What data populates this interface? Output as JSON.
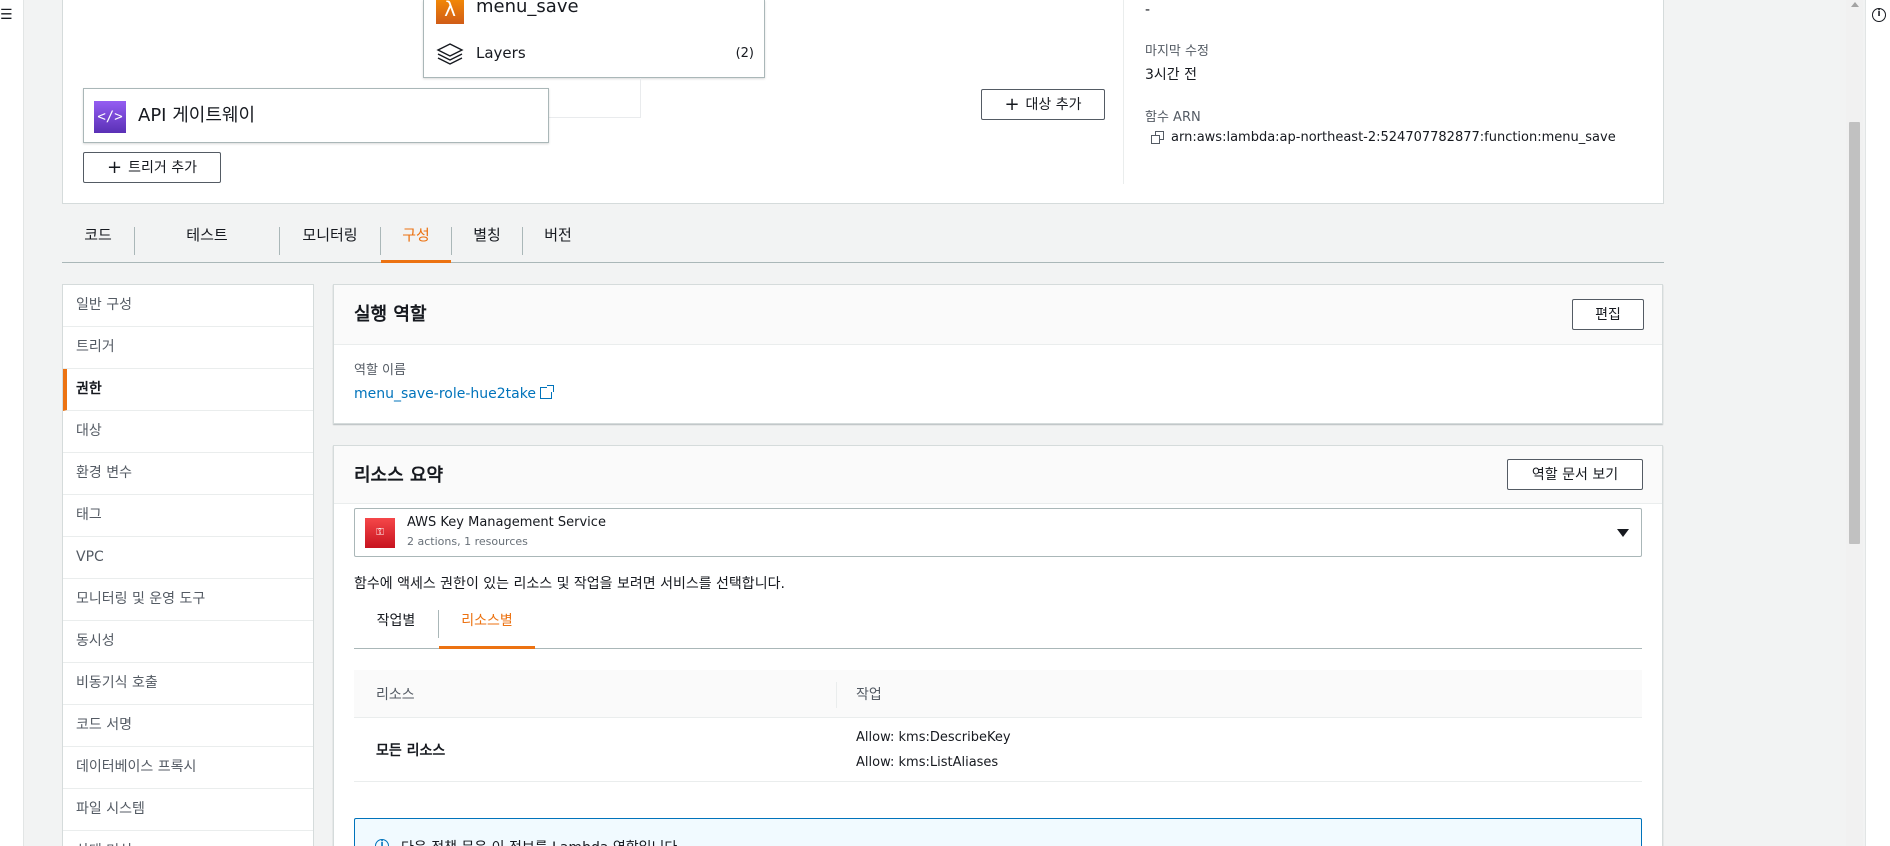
{
  "function_overview": {
    "function_name": "menu_save",
    "layers_label": "Layers",
    "layers_count": "(2)",
    "trigger_label": "API 게이트웨이",
    "add_trigger_label": "트리거 추가",
    "add_destination_label": "대상 추가",
    "description_value": "-",
    "last_modified_label": "마지막 수정",
    "last_modified_value": "3시간 전",
    "arn_label": "함수 ARN",
    "arn_value": "arn:aws:lambda:ap-northeast-2:524707782877:function:menu_save"
  },
  "tabs": [
    {
      "label": "코드"
    },
    {
      "label": "테스트"
    },
    {
      "label": "모니터링"
    },
    {
      "label": "구성"
    },
    {
      "label": "별칭"
    },
    {
      "label": "버전"
    }
  ],
  "active_tab": "구성",
  "sidenav": {
    "items": [
      {
        "label": "일반 구성"
      },
      {
        "label": "트리거"
      },
      {
        "label": "권한"
      },
      {
        "label": "대상"
      },
      {
        "label": "환경 변수"
      },
      {
        "label": "태그"
      },
      {
        "label": "VPC"
      },
      {
        "label": "모니터링 및 운영 도구"
      },
      {
        "label": "동시성"
      },
      {
        "label": "비동기식 호출"
      },
      {
        "label": "코드 서명"
      },
      {
        "label": "데이터베이스 프록시"
      },
      {
        "label": "파일 시스템"
      },
      {
        "label": "상태 머신"
      }
    ],
    "active_item": "권한"
  },
  "execution_role": {
    "title": "실행 역할",
    "edit_label": "편집",
    "role_name_label": "역할 이름",
    "role_name_value": "menu_save-role-hue2take"
  },
  "resource_summary": {
    "title": "리소스 요약",
    "view_doc_label": "역할 문서 보기",
    "service_name": "AWS Key Management Service",
    "service_detail": "2 actions, 1 resources",
    "hint": "함수에 액세스 권한이 있는 리소스 및 작업을 보려면 서비스를 선택합니다.",
    "subtabs": [
      {
        "label": "작업별"
      },
      {
        "label": "리소스별"
      }
    ],
    "active_subtab": "리소스별",
    "table": {
      "headers": [
        "리소스",
        "작업"
      ],
      "rows": [
        {
          "resource": "모든 리소스",
          "actions": [
            "Allow: kms:DescribeKey",
            "Allow: kms:ListAliases"
          ]
        }
      ]
    },
    "info_text": "다음 정책 문은 이 정보를 Lambda 역할입니다"
  },
  "icons": {
    "menu": "menu-icon",
    "info": "info-icon",
    "lambda": "lambda-icon",
    "layers": "layers-icon",
    "api_gateway": "api-gateway-icon",
    "copy": "copy-icon",
    "external_link": "external-link-icon",
    "kms": "kms-icon",
    "dropdown": "caret-down-icon"
  },
  "colors": {
    "accent": "#ec7211",
    "link": "#0073bb",
    "lambda": "#f78e04",
    "api_gateway": "#945df2",
    "kms": "#dd344c"
  }
}
